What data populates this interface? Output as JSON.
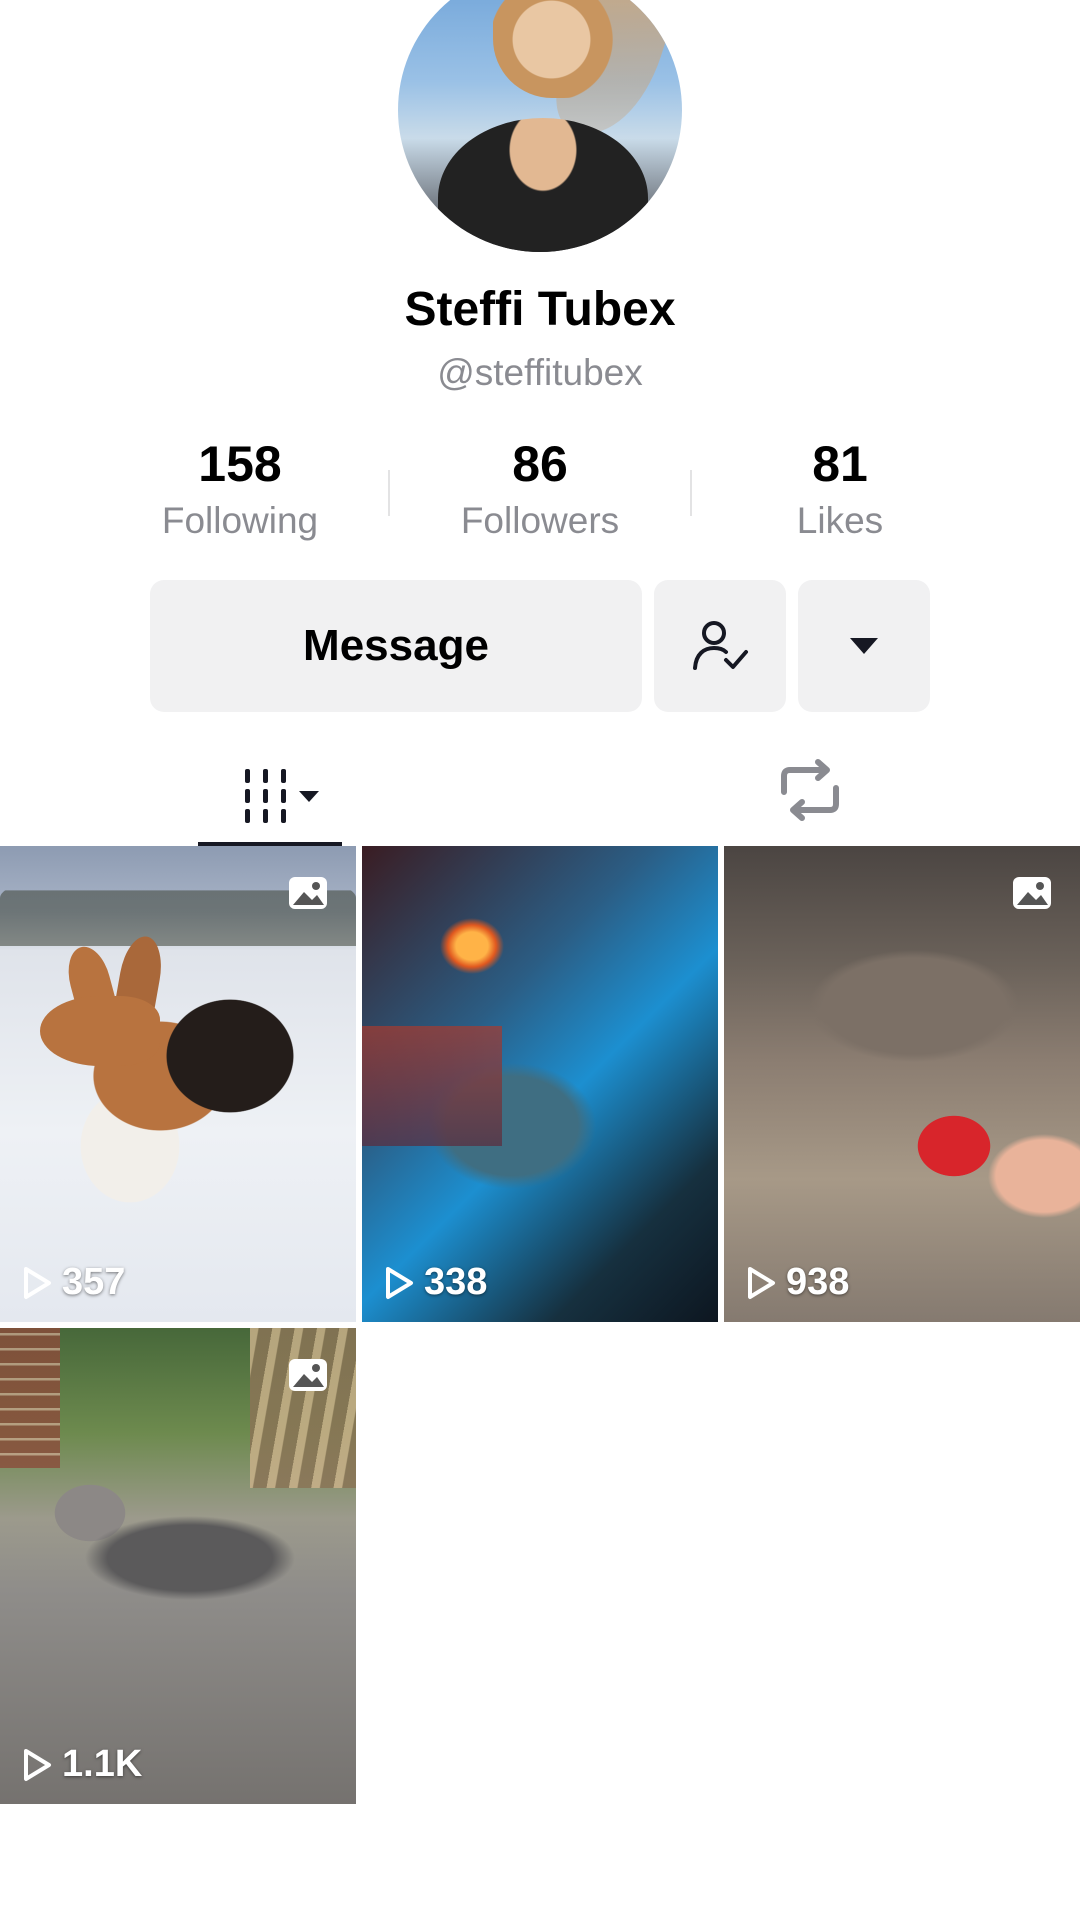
{
  "profile": {
    "name": "Steffi Tubex",
    "handle": "@steffitubex"
  },
  "stats": [
    {
      "value": "158",
      "label": "Following"
    },
    {
      "value": "86",
      "label": "Followers"
    },
    {
      "value": "81",
      "label": "Likes"
    }
  ],
  "actions": {
    "message_label": "Message",
    "follow_icon": "user-check-icon",
    "more_icon": "caret-down-icon"
  },
  "tabs": [
    {
      "icon": "grid-dropdown-icon",
      "selected": true
    },
    {
      "icon": "repost-icon",
      "selected": false
    }
  ],
  "videos": [
    {
      "views": "357",
      "is_photo": true
    },
    {
      "views": "338",
      "is_photo": false
    },
    {
      "views": "938",
      "is_photo": true
    },
    {
      "views": "1.1K",
      "is_photo": true
    }
  ],
  "colors": {
    "text_primary": "#000000",
    "text_secondary": "#8a8b91",
    "button_bg": "#f1f1f2",
    "tab_indicator": "#161823"
  }
}
